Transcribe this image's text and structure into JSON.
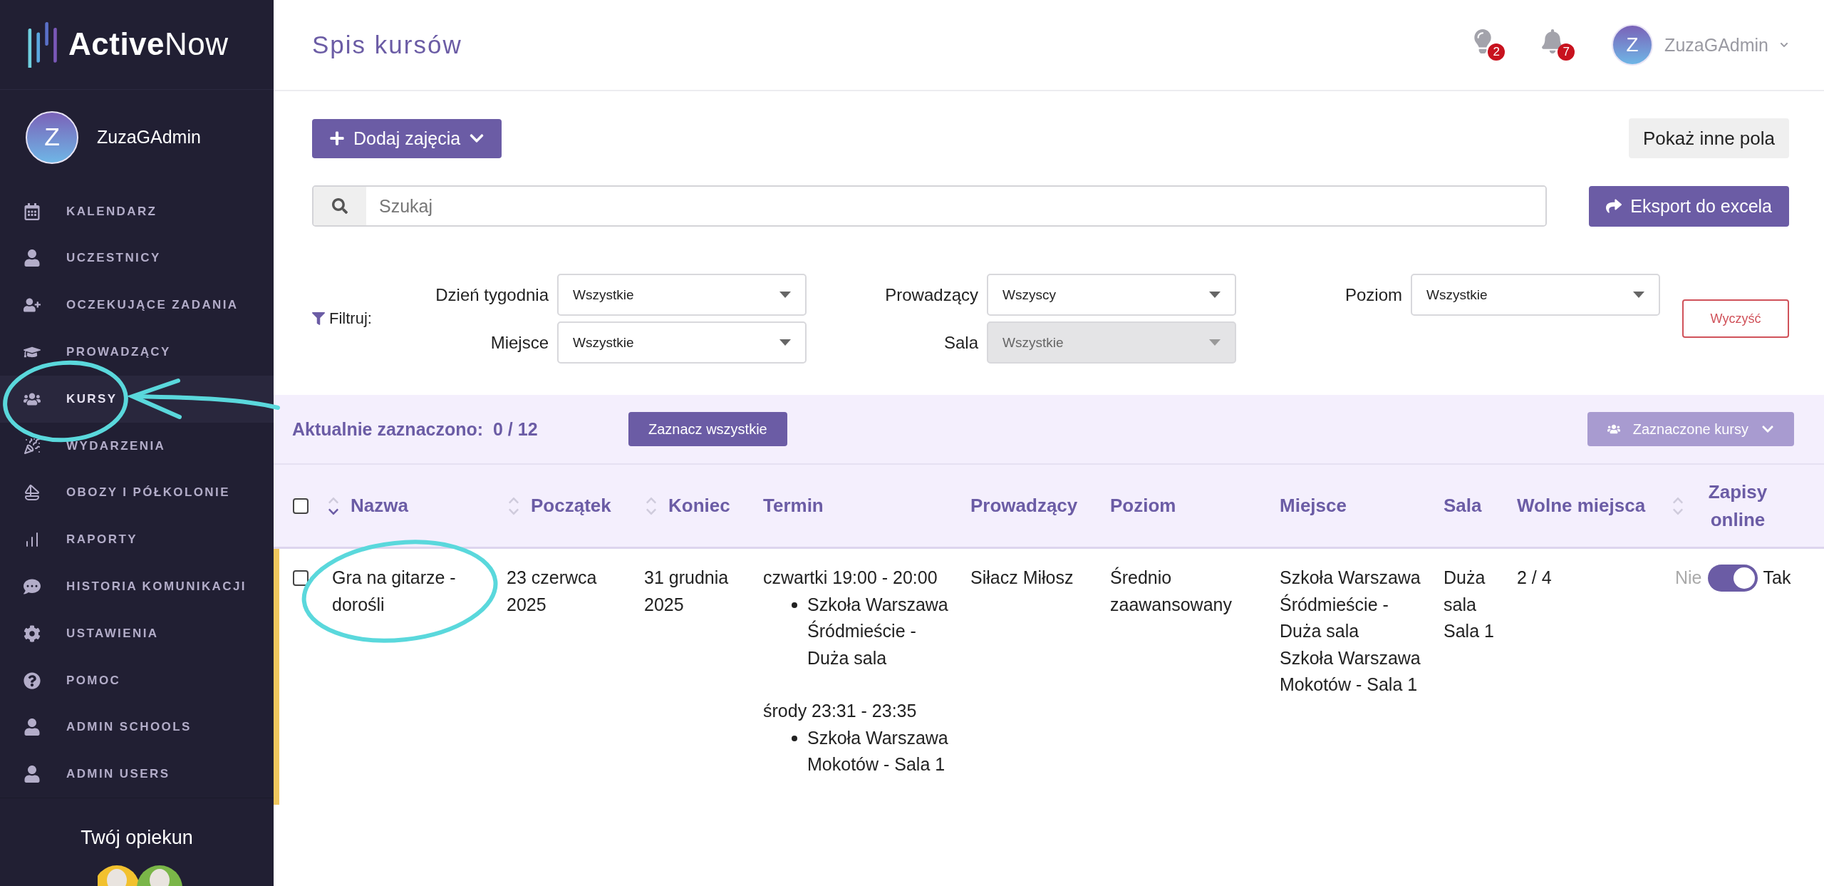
{
  "sidebar": {
    "logo": "**Active**Now",
    "user": {
      "initial": "Z",
      "name": "ZuzaGAdmin"
    },
    "items": [
      {
        "label": "KALENDARZ",
        "selected": false
      },
      {
        "label": "UCZESTNICY",
        "selected": false
      },
      {
        "label": "OCZEKUJĄCE ZADANIA",
        "selected": false
      },
      {
        "label": "PROWADZĄCY",
        "selected": false
      },
      {
        "label": "KURSY",
        "selected": true
      },
      {
        "label": "WYDARZENIA",
        "selected": false
      },
      {
        "label": "OBOZY I PÓŁKOLONIE",
        "selected": false
      },
      {
        "label": "RAPORTY",
        "selected": false
      },
      {
        "label": "HISTORIA KOMUNIKACJI",
        "selected": false
      },
      {
        "label": "USTAWIENIA",
        "selected": false
      },
      {
        "label": "POMOC",
        "selected": false
      },
      {
        "label": "ADMIN SCHOOLS",
        "selected": false
      },
      {
        "label": "ADMIN USERS",
        "selected": false
      }
    ],
    "footer": {
      "title": "Twój opiekun"
    }
  },
  "header": {
    "title": "Spis kursów",
    "notifications": [
      {
        "kind": "bulb",
        "badge": "2"
      },
      {
        "kind": "bell",
        "badge": "7"
      }
    ],
    "user": {
      "initial": "Z",
      "name": "ZuzaGAdmin"
    }
  },
  "toolbar": {
    "add_button": "Dodaj zajęcia",
    "fields_button": "Pokaż inne pola",
    "search": {
      "placeholder": "Szukaj"
    },
    "export_button": "Eksport do excela"
  },
  "filters": {
    "label": "Filtruj:",
    "fields": [
      {
        "label": "Dzień tygodnia",
        "value": "Wszystkie",
        "disabled": false
      },
      {
        "label": "Miejsce",
        "value": "Wszystkie",
        "disabled": false
      },
      {
        "label": "Prowadzący",
        "value": "Wszyscy",
        "disabled": false
      },
      {
        "label": "Sala",
        "value": "Wszystkie",
        "disabled": true
      },
      {
        "label": "Poziom",
        "value": "Wszystkie",
        "disabled": false
      }
    ],
    "clear_button": "Wyczyść"
  },
  "selection": {
    "label": "Aktualnie zaznaczono:  0 / 12",
    "select_all_button": "Zaznacz wszystkie",
    "bulk_button": {
      "label": "Zaznaczone kursy",
      "disabled": true
    }
  },
  "table": {
    "select_all_checked": false,
    "columns": [
      {
        "label": "Nazwa",
        "sort_desc": true
      },
      {
        "label": "Początek",
        "sort_desc": false
      },
      {
        "label": "Koniec",
        "sort_desc": false
      },
      {
        "label": "Termin"
      },
      {
        "label": "Prowadzący"
      },
      {
        "label": "Poziom"
      },
      {
        "label": "Miejsce"
      },
      {
        "label": "Sala"
      },
      {
        "label": "Wolne miejsca"
      },
      {
        "label": "Zapisy online",
        "sort_desc": false
      }
    ],
    "rows": [
      {
        "checked": false,
        "color": "#f0c75e",
        "name": "Gra na gitarze - dorośli",
        "start": "23 czerwca 2025",
        "end": "31 grudnia 2025",
        "schedule": [
          {
            "time": "czwartki 19:00 - 20:00",
            "places": [
              "Szkoła Warszawa Śródmieście - Duża sala"
            ]
          },
          {
            "time": "środy 23:31 - 23:35",
            "places": [
              "Szkoła Warszawa Mokotów - Sala 1"
            ]
          }
        ],
        "teacher": "Siłacz Miłosz",
        "level": "Średnio zaawansowany",
        "places": [
          "Szkoła Warszawa Śródmieście - Duża sala",
          "Szkoła Warszawa Mokotów - Sala 1"
        ],
        "rooms": [
          "Duża sala",
          "Sala 1"
        ],
        "free_spots": "2 / 4",
        "online": {
          "off_label": "Nie",
          "on_label": "Tak",
          "on": true
        }
      }
    ]
  }
}
